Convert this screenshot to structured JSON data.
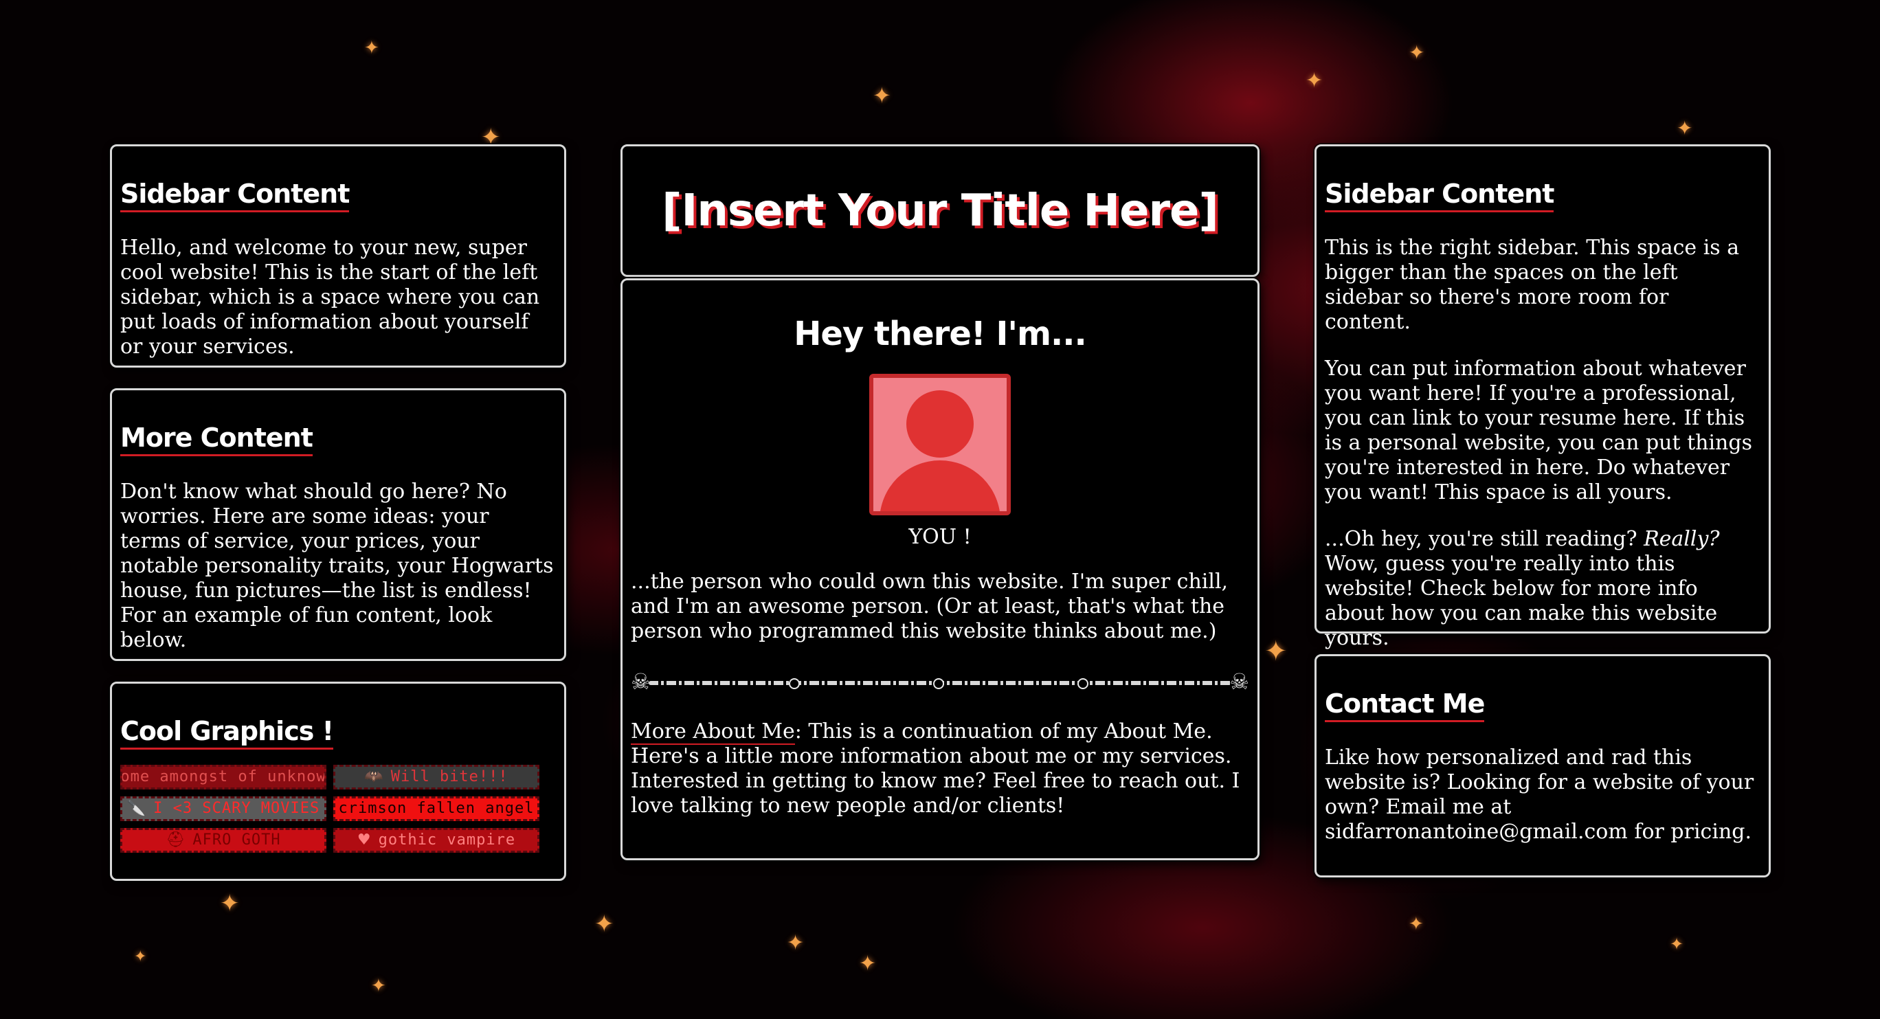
{
  "page": {
    "title": "[Insert Your Title Here]"
  },
  "left_sidebar": {
    "panel1": {
      "title": "Sidebar Content",
      "text": "Hello, and welcome to your new, super cool website! This is the start of the left sidebar, which is a space where you can put loads of information about yourself or your services."
    },
    "panel2": {
      "title": "More Content",
      "text": "Don't know what should go here? No worries. Here are some ideas: your terms of service, your prices, your notable personality traits, your Hogwarts house, fun pictures—the list is endless! For an example of fun content, look below."
    },
    "panel3": {
      "title": "Cool Graphics !",
      "badges": [
        {
          "label": "rome amongst of unknown",
          "bg": "#8a0c12",
          "fg": "#e05050",
          "icon": ""
        },
        {
          "label": "Will bite!!!",
          "bg": "#3a3a3a",
          "fg": "#e0353a",
          "icon": "🦇"
        },
        {
          "label": "I <3 SCARY MOVIES",
          "bg": "#5a5a5a",
          "fg": "#ff2a2a",
          "icon": "🔪"
        },
        {
          "label": "crimson fallen angel",
          "bg": "#f01010",
          "fg": "#1a0000",
          "icon": ""
        },
        {
          "label": "AFRO GOTH",
          "bg": "#c80d14",
          "fg": "#7a0000",
          "icon": "⛑"
        },
        {
          "label": "gothic vampire",
          "bg": "#b00c12",
          "fg": "#ff8080",
          "icon": "♥"
        }
      ]
    }
  },
  "main": {
    "heading": "Hey there! I'm...",
    "avatar_caption": "YOU !",
    "intro": "...the person who could own this website. I'm super chill, and I'm an awesome person. (Or at least, that's what the person who programmed this website thinks about me.)",
    "more_label": "More About Me",
    "more_text": ": This is a continuation of my About Me. Here's a little more information about me or my services. Interested in getting to know me? Feel free to reach out. I love talking to new people and/or clients!"
  },
  "right_sidebar": {
    "panel1": {
      "title": "Sidebar Content",
      "para1": "This is the right sidebar. This space is a bigger than the spaces on the left sidebar so there's more room for content.",
      "para2": "You can put information about whatever you want here! If you're a professional, you can link to your resume here. If this is a personal website, you can put things you're interested in here. Do whatever you want! This space is all yours.",
      "para3_start": "...Oh hey, you're still reading? ",
      "para3_em": "Really?",
      "para3_end": " Wow, guess you're really into this website! Check below for more info about how you can make this website yours."
    },
    "panel2": {
      "title": "Contact Me",
      "text_start": "Like how personalized and rad this website is? Looking for a website of your own? Email me at ",
      "email": "sidfarronantoine@gmail.com",
      "text_end": " for pricing."
    }
  },
  "colors": {
    "accent": "#d11c24",
    "panel_bg": "#000000",
    "panel_border": "#d9d9d9",
    "avatar_bg": "#f28089",
    "avatar_figure": "#e03232"
  }
}
